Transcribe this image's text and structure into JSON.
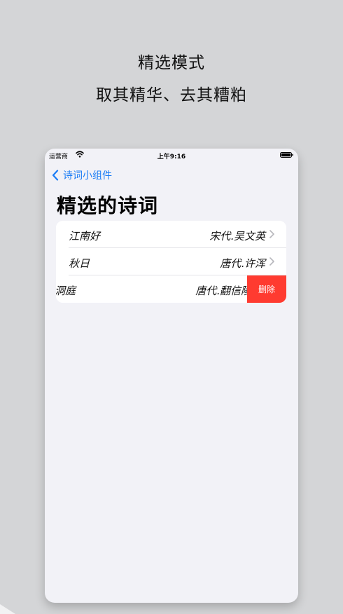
{
  "promo": {
    "title": "精选模式",
    "subtitle": "取其精华、去其糟粕"
  },
  "status_bar": {
    "carrier": "运营商",
    "time": "上午9:16"
  },
  "nav": {
    "back_label": "诗词小组件"
  },
  "page": {
    "title": "精选的诗词"
  },
  "poems": [
    {
      "title": "江南好",
      "author": "宋代.吴文英"
    },
    {
      "title": "秋日",
      "author": "唐代.许浑"
    },
    {
      "title": "洞庭",
      "author": "唐代.翻信陵"
    }
  ],
  "swipe_action": {
    "delete_label": "删除"
  },
  "colors": {
    "accent": "#1a7cf5",
    "delete": "#ff3b30",
    "background": "#f2f2f7"
  }
}
